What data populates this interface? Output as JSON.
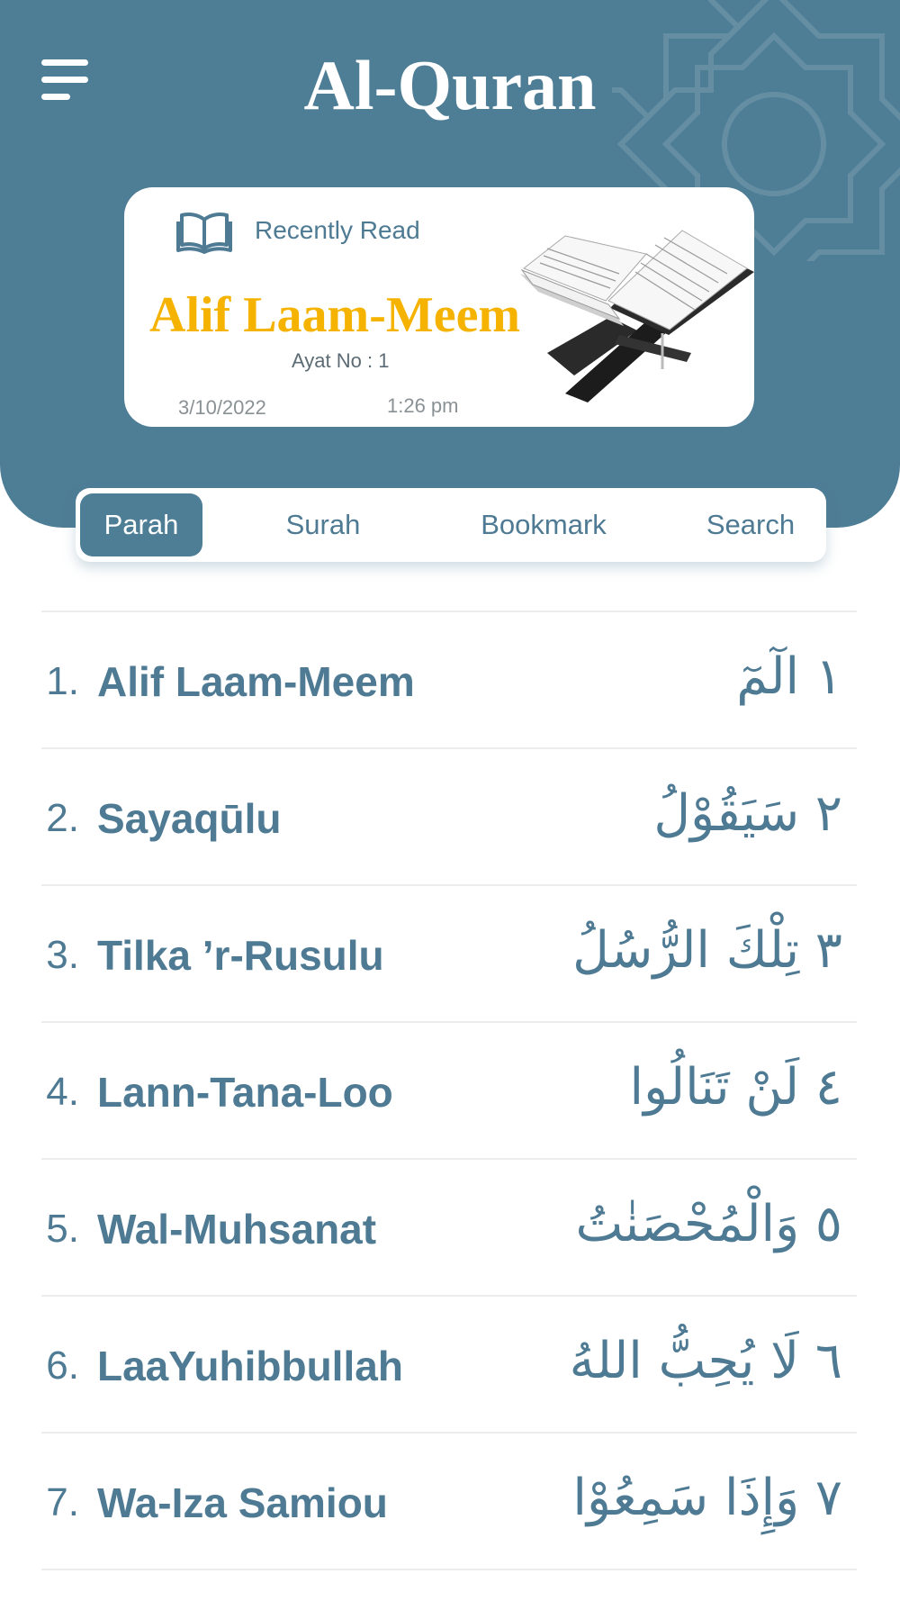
{
  "app": {
    "title": "Al-Quran"
  },
  "recent": {
    "label": "Recently Read",
    "name": "Alif Laam-Meem",
    "ayat": "Ayat No : 1",
    "date": "3/10/2022",
    "time": "1:26 pm"
  },
  "tabs": [
    {
      "label": "Parah",
      "active": true
    },
    {
      "label": "Surah",
      "active": false
    },
    {
      "label": "Bookmark",
      "active": false
    },
    {
      "label": "Search",
      "active": false
    }
  ],
  "parahs": [
    {
      "num": "1.",
      "name": "Alif Laam-Meem",
      "arabic": "١  الٓمٓ"
    },
    {
      "num": "2.",
      "name": "Sayaqūlu",
      "arabic": "٢  سَيَقُوْلُ"
    },
    {
      "num": "3.",
      "name": "Tilka ’r-Rusulu",
      "arabic": "٣  تِلْكَ الرُّسُلُ"
    },
    {
      "num": "4.",
      "name": "Lann-Tana-Loo",
      "arabic": "٤  لَنْ تَنَالُوا"
    },
    {
      "num": "5.",
      "name": "Wal-Muhsanat",
      "arabic": "٥  وَالْمُحْصَنٰتُ"
    },
    {
      "num": "6.",
      "name": "LaaYuhibbullah",
      "arabic": "٦  لَا يُحِبُّ اللهُ"
    },
    {
      "num": "7.",
      "name": "Wa-Iza Samiou",
      "arabic": "٧  وَإِذَا سَمِعُوْا"
    }
  ],
  "colors": {
    "primary": "#4e7d96",
    "accent": "#f5b300",
    "background": "#ffffff"
  }
}
